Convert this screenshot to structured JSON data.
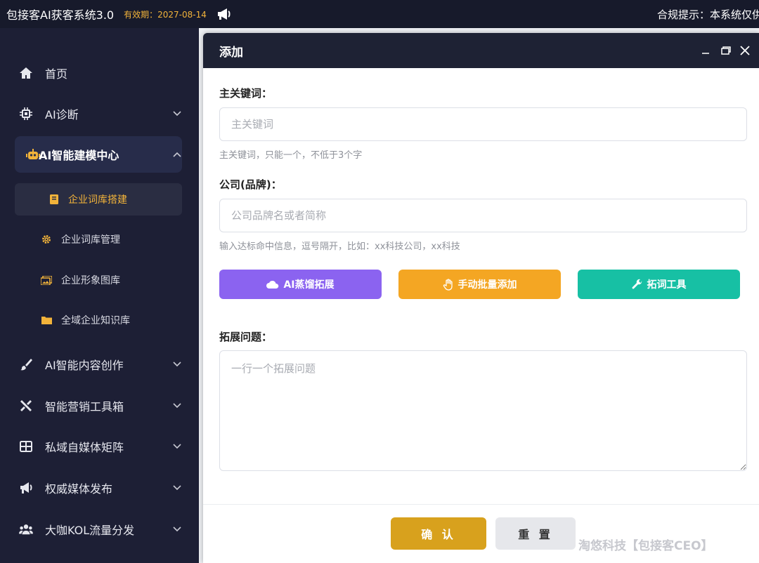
{
  "header": {
    "app_title": "包接客AI获客系统3.0",
    "validity": "有效期：2027-08-14",
    "notice": "合规提示：本系统仅供"
  },
  "sidebar": {
    "items": [
      {
        "label": "首页",
        "icon": "home-icon"
      },
      {
        "label": "AI诊断",
        "icon": "chip-icon"
      },
      {
        "label": "AI智能建模中心",
        "icon": "robot-icon"
      },
      {
        "label": "AI智能内容创作",
        "icon": "brush-icon"
      },
      {
        "label": "智能营销工具箱",
        "icon": "tools-icon"
      },
      {
        "label": "私域自媒体矩阵",
        "icon": "grid-icon"
      },
      {
        "label": "权威媒体发布",
        "icon": "megaphone-icon"
      },
      {
        "label": "大咖KOL流量分发",
        "icon": "users-icon"
      }
    ],
    "sub_items": [
      {
        "label": "企业词库搭建",
        "icon": "book-icon"
      },
      {
        "label": "企业词库管理",
        "icon": "gear-icon"
      },
      {
        "label": "企业形象图库",
        "icon": "image-icon"
      },
      {
        "label": "全域企业知识库",
        "icon": "folder-icon"
      }
    ]
  },
  "modal": {
    "title": "添加",
    "main_keyword": {
      "label": "主关键词：",
      "placeholder": "主关键词",
      "hint": "主关键词，只能一个，不低于3个字"
    },
    "company": {
      "label": "公司(品牌)：",
      "placeholder": "公司品牌名或者简称",
      "hint": "输入达标命中信息，逗号隔开，比如：xx科技公司，xx科技"
    },
    "buttons": {
      "ai_expand": "AI蒸馏拓展",
      "manual_add": "手动批量添加",
      "word_tool": "拓词工具"
    },
    "questions": {
      "label": "拓展问题：",
      "placeholder": "一行一个拓展问题"
    },
    "footer": {
      "confirm": "确 认",
      "reset": "重 置"
    }
  },
  "watermark": "淘悠科技【包接客CEO】",
  "colors": {
    "purple": "#8b63f0",
    "orange": "#f4a623",
    "teal": "#17c0a4",
    "gold": "#d8a11d",
    "sidebar_bg": "#1d1f35",
    "accent": "#f2b33a"
  }
}
